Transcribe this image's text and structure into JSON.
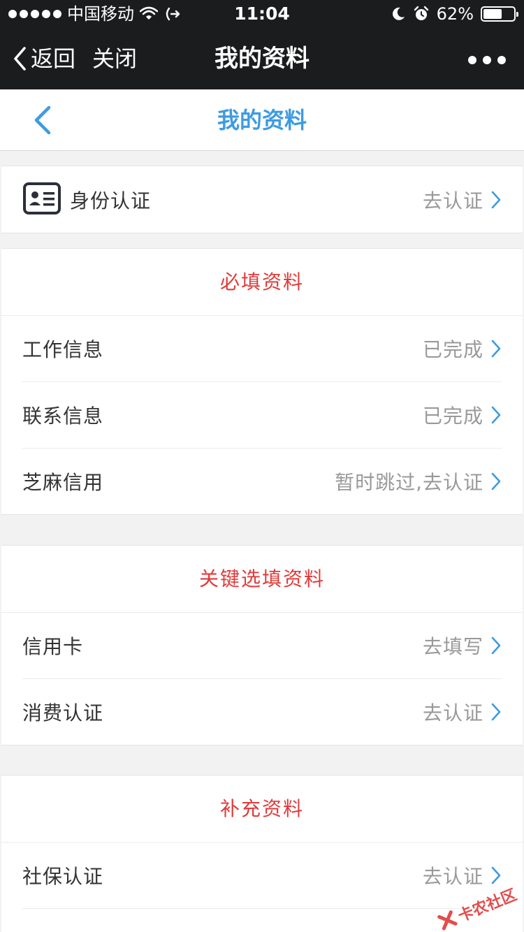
{
  "status_bar": {
    "carrier": "中国移动",
    "time": "11:04",
    "battery": "62%",
    "battery_level": 0.62
  },
  "nav_bar": {
    "back_label": "返回",
    "close_label": "关闭",
    "title": "我的资料"
  },
  "page_header": {
    "title": "我的资料"
  },
  "identity": {
    "label": "身份认证",
    "value": "去认证"
  },
  "required": {
    "header": "必填资料",
    "items": [
      {
        "label": "工作信息",
        "value": "已完成"
      },
      {
        "label": "联系信息",
        "value": "已完成"
      },
      {
        "label": "芝麻信用",
        "value": "暂时跳过,去认证"
      }
    ]
  },
  "key_optional": {
    "header": "关键选填资料",
    "items": [
      {
        "label": "信用卡",
        "value": "去填写"
      },
      {
        "label": "消费认证",
        "value": "去认证"
      }
    ]
  },
  "supplementary": {
    "header": "补充资料",
    "items": [
      {
        "label": "社保认证",
        "value": "去认证"
      }
    ]
  },
  "watermark": "卡农社区",
  "colors": {
    "accent": "#3d9be2",
    "section_header": "#e03a3a",
    "navbar_bg": "#1b1c1e",
    "page_bg": "#f2f2f2"
  }
}
